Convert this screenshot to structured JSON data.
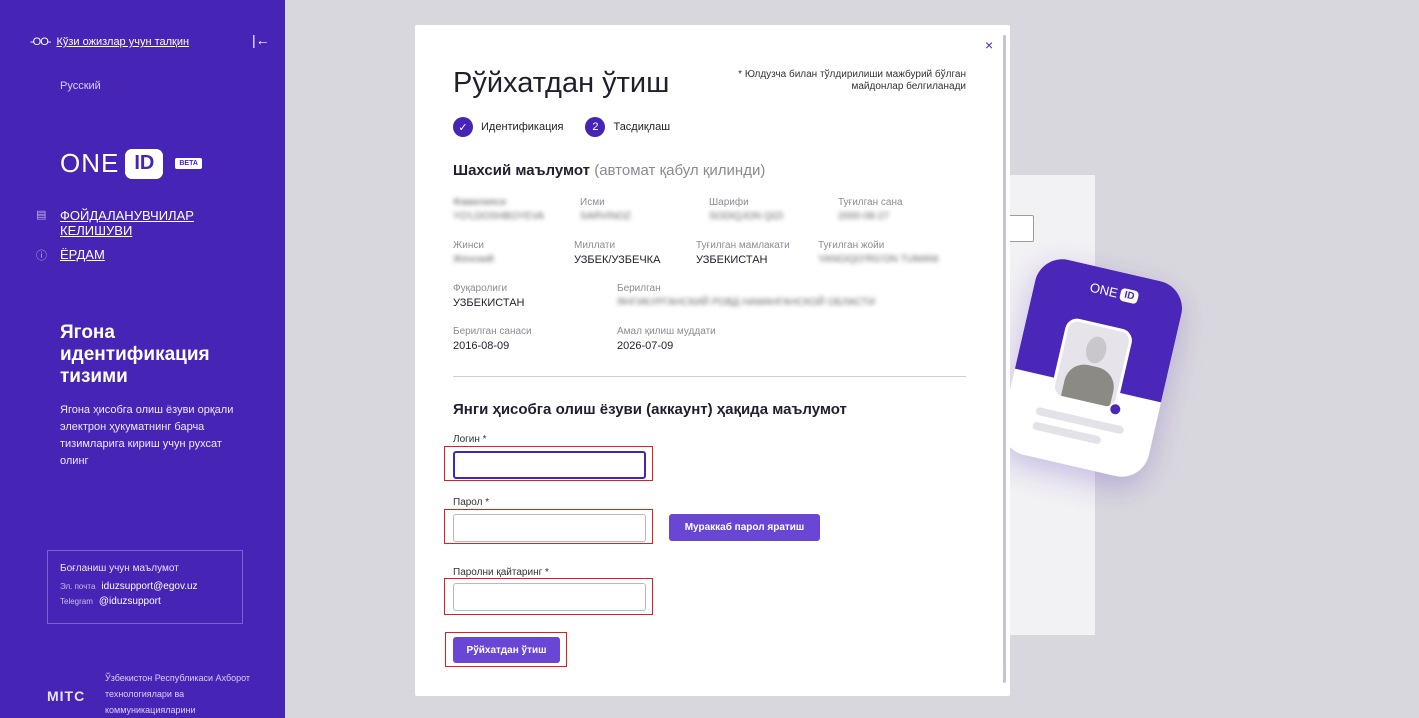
{
  "sidebar": {
    "accessibility": "Кўзи ожизлар учун талқин",
    "accessibility_icon": "glasses-icon",
    "language": "Русский",
    "logo_text": "ONE",
    "logo_id": "ID",
    "logo_beta": "BETA",
    "nav": [
      {
        "label": "ФОЙДАЛАНУВЧИЛАР КЕЛИШУВИ",
        "icon": "document-icon"
      },
      {
        "label": "ЁРДАМ",
        "icon": "help-circle-icon"
      }
    ],
    "heading": "Ягона идентификация тизими",
    "description": "Ягона ҳисобга олиш ёзуви орқали электрон ҳукуматнинг барча тизимларига кириш учун рухсат олинг",
    "contact": {
      "title": "Боғланиш учун маълумот",
      "email_label": "Эл. почта",
      "email": "iduzsupport@egov.uz",
      "telegram_label": "Telegram",
      "telegram": "@iduzsupport"
    },
    "footer_logo": "MITC",
    "footer_text": "Ўзбекистон Республикаси Ахборот технологиялари ва коммуникацияларини"
  },
  "float_card": {
    "logo_text": "ONE",
    "logo_id": "ID"
  },
  "modal": {
    "close": "×",
    "title": "Рўйхатдан ўтиш",
    "required_note": "* Юлдузча билан тўлдирилиши мажбурий бўлган майдонлар белгиланади",
    "steps": [
      {
        "marker": "✓",
        "label": "Идентификация"
      },
      {
        "marker": "2",
        "label": "Тасдиқлаш"
      }
    ],
    "personal": {
      "title": "Шахсий маълумот",
      "subtitle": "(автомат қабул қилинди)",
      "fields": {
        "surname": {
          "label": "Фамилияси",
          "value": "YO'LDOSHBOYEVA"
        },
        "name": {
          "label": "Исми",
          "value": "SARVINOZ"
        },
        "patronymic": {
          "label": "Шарифи",
          "value": "SODIQJON QIZI"
        },
        "birth_date": {
          "label": "Туғилган сана",
          "value": "2000-08-27"
        },
        "gender": {
          "label": "Жинси",
          "value": "Женский"
        },
        "nationality": {
          "label": "Миллати",
          "value": "УЗБЕК/УЗБЕЧКА"
        },
        "birth_country": {
          "label": "Туғилган мамлакати",
          "value": "УЗБЕКИСТАН"
        },
        "birth_place": {
          "label": "Туғилган жойи",
          "value": "YANGIQO'RG'ON TUMANI"
        },
        "citizenship": {
          "label": "Фуқаролиги",
          "value": "УЗБЕКИСТАН"
        },
        "issued_by": {
          "label": "Берилган",
          "value": "ЯНГИКУРГАНСКИЙ РОВД НАМАНГАНСКОЙ ОБЛАСТИ"
        },
        "issue_date": {
          "label": "Берилган санаси",
          "value": "2016-08-09"
        },
        "expiry": {
          "label": "Амал қилиш муддати",
          "value": "2026-07-09"
        }
      }
    },
    "account": {
      "title": "Янги ҳисобга олиш ёзуви (аккаунт) ҳақида маълумот",
      "login_label": "Логин *",
      "login_value": "",
      "password_label": "Парол *",
      "password_value": "",
      "generate_button": "Мураккаб парол яратиш",
      "repeat_label": "Паролни қайтаринг *",
      "repeat_value": "",
      "submit_button": "Рўйхатдан ўтиш"
    }
  },
  "colors": {
    "primary": "#4624b5",
    "button": "#6a46d4",
    "highlight": "#e0201e"
  }
}
